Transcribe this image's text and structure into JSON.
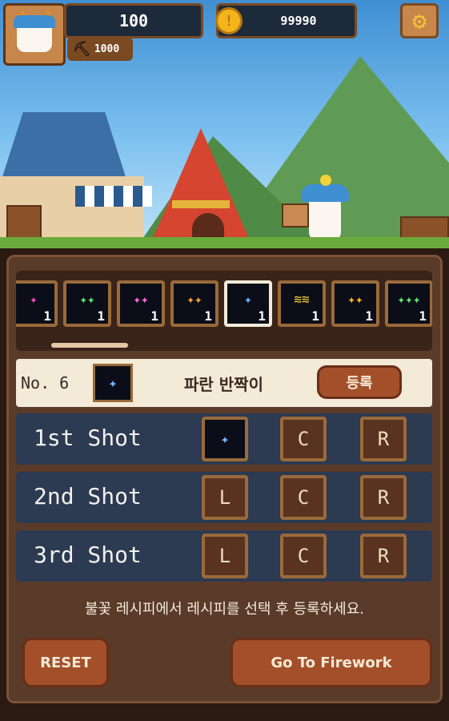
{
  "hud": {
    "hp": "100",
    "pickaxe": "1000",
    "coins": "99990",
    "coin_symbol": "!"
  },
  "inventory": {
    "slots": [
      {
        "count": "1",
        "color": "#ff49c2",
        "spark": "✦"
      },
      {
        "count": "1",
        "color": "#5fe36b",
        "spark": "✦✦"
      },
      {
        "count": "1",
        "color": "#ff6ad5",
        "spark": "✦✦"
      },
      {
        "count": "1",
        "color": "#ffa23a",
        "spark": "✦✦"
      },
      {
        "count": "1",
        "color": "#6fb6ff",
        "spark": "✦"
      },
      {
        "count": "1",
        "color": "#ffd23a",
        "spark": "≋≋"
      },
      {
        "count": "1",
        "color": "#ffb32e",
        "spark": "✦✦"
      },
      {
        "count": "1",
        "color": "#5fe36b",
        "spark": "✦✦✦"
      }
    ],
    "selected_index": 4
  },
  "recipe": {
    "number": "No. 6",
    "name": "파란 반짝이",
    "register_label": "등록"
  },
  "shots": [
    {
      "label": "1st Shot",
      "left": "",
      "center": "C",
      "right": "R"
    },
    {
      "label": "2nd Shot",
      "left": "L",
      "center": "C",
      "right": "R"
    },
    {
      "label": "3rd Shot",
      "left": "L",
      "center": "C",
      "right": "R"
    }
  ],
  "hint": "불꽃 레시피에서 레시피를 선택 후 등록하세요.",
  "buttons": {
    "reset": "RESET",
    "go": "Go To Firework"
  }
}
